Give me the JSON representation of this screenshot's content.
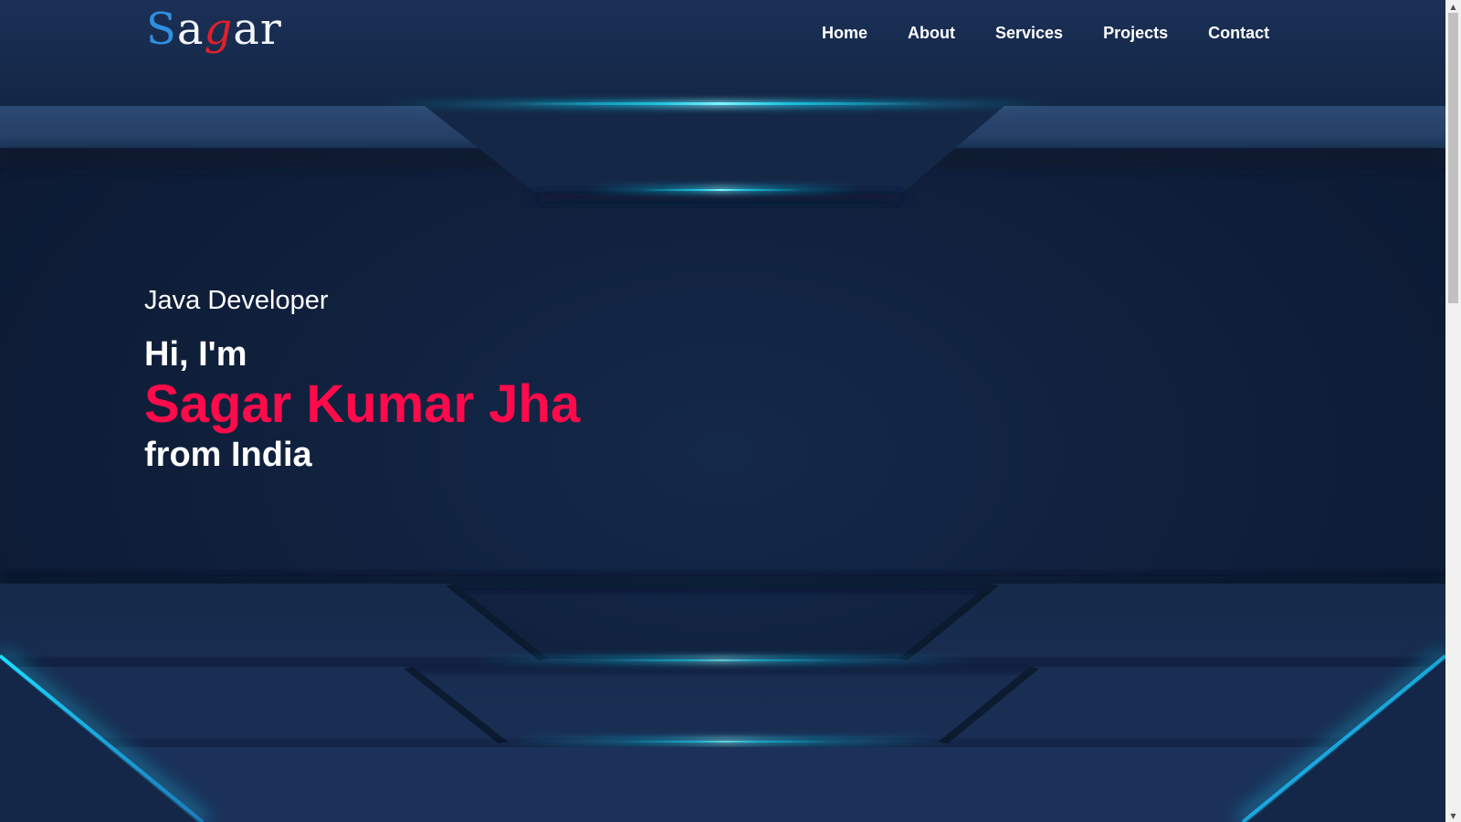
{
  "logo": {
    "letters": [
      {
        "char": "S",
        "color": "blue"
      },
      {
        "char": "a",
        "color": "white"
      },
      {
        "char": "g",
        "color": "red"
      },
      {
        "char": "a",
        "color": "white"
      },
      {
        "char": "r",
        "color": "white"
      }
    ]
  },
  "nav": {
    "items": [
      {
        "label": "Home"
      },
      {
        "label": "About"
      },
      {
        "label": "Services"
      },
      {
        "label": "Projects"
      },
      {
        "label": "Contact"
      }
    ]
  },
  "hero": {
    "subtitle": "Java Developer",
    "greeting": "Hi, I'm",
    "name": "Sagar Kumar Jha",
    "origin": "from India"
  },
  "colors": {
    "background": "#0f1f3a",
    "panel": "#1a2d4f",
    "glow": "#19e0ff",
    "accent_name": "#ff0a4a",
    "logo_blue": "#2f8fe0",
    "logo_red": "#e0202c"
  },
  "scrollbar": {
    "up_icon": "scroll-up-arrow-icon",
    "down_icon": "scroll-down-arrow-icon"
  }
}
